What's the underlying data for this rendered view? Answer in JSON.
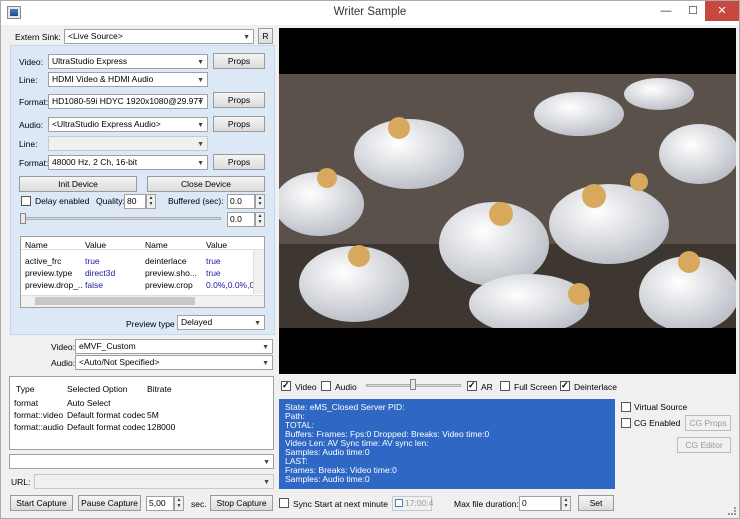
{
  "window": {
    "title": "Writer Sample",
    "minimize": "—",
    "maximize": "☐",
    "close": "✕"
  },
  "sink": {
    "label": "Extern Sink:",
    "value": "<Live Source>",
    "button": "R"
  },
  "device": {
    "video_label": "Video:",
    "video_value": "UltraStudio Express",
    "video_props": "Props",
    "line_label": "Line:",
    "line_value": "HDMI Video & HDMI Audio",
    "format_label": "Format:",
    "format_value": "HD1080-59i HDYC 1920x1080@29.97T",
    "format_props": "Props",
    "audio_label": "Audio:",
    "audio_value": "<UltraStudio Express Audio>",
    "audio_props": "Props",
    "aline_label": "Line:",
    "aline_value": "",
    "aformat_label": "Format:",
    "aformat_value": "48000 Hz, 2 Ch, 16-bit",
    "aformat_props": "Props",
    "init_button": "Init Device",
    "close_button": "Close Device",
    "delay_label": "Delay enabled",
    "quality_label": "Quality:",
    "quality_value": "80",
    "buffered_label": "Buffered (sec):",
    "buffered_value": "0.0",
    "slider_value": "0.0"
  },
  "props_grid": {
    "headers": [
      "Name",
      "Value",
      "Name",
      "Value"
    ],
    "rows": [
      [
        "active_frc",
        "true",
        "deinterlace",
        "true"
      ],
      [
        "preview.type",
        "direct3d",
        "preview.sho...",
        "true"
      ],
      [
        "preview.drop_...",
        "false",
        "preview.crop",
        "0.0%,0.0%,0..."
      ]
    ]
  },
  "preview": {
    "label": "Preview type",
    "value": "Delayed"
  },
  "encoder": {
    "video_label": "Video:",
    "video_value": "eMVF_Custom",
    "audio_label": "Audio:",
    "audio_value": "<Auto/Not Specified>"
  },
  "options_grid": {
    "headers": [
      "Type",
      "Selected Option",
      "Bitrate"
    ],
    "rows": [
      [
        "format",
        "Auto Select",
        ""
      ],
      [
        "format::video",
        "Default format codec",
        "5M"
      ],
      [
        "format::audio",
        "Default format codec",
        "128000"
      ]
    ]
  },
  "bottom": {
    "combo_value": "",
    "url_label": "URL:",
    "url_value": "",
    "start_capture": "Start Capture",
    "pause_capture": "Pause Capture",
    "duration_value": "5,00",
    "sec_label": "sec.",
    "stop_capture": "Stop Capture",
    "sync_label": "Sync Start at next minute",
    "time_value": "17:00:4",
    "max_label": "Max file duration:",
    "max_value": "0",
    "set_button": "Set"
  },
  "controls": {
    "video_label": "Video",
    "audio_label": "Audio",
    "ar_label": "AR",
    "fullscreen_label": "Full Screen",
    "deinterlace_label": "Deinterlace"
  },
  "status_lines": [
    "State: eMS_Closed Server PID:",
    "Path:",
    "TOTAL:",
    "  Buffers: Frames: Fps:0 Dropped: Breaks:  Video time:0",
    "Video Len: AV Sync time: AV sync len:",
    "  Samples: Audio time:0",
    "LAST:",
    "  Frames: Breaks: Video time:0",
    "  Samples: Audio time:0"
  ],
  "right": {
    "virtual_source": "Virtual Source",
    "cg_enabled": "CG Enabled",
    "cg_props": "CG Props",
    "cg_editor": "CG Editor"
  }
}
